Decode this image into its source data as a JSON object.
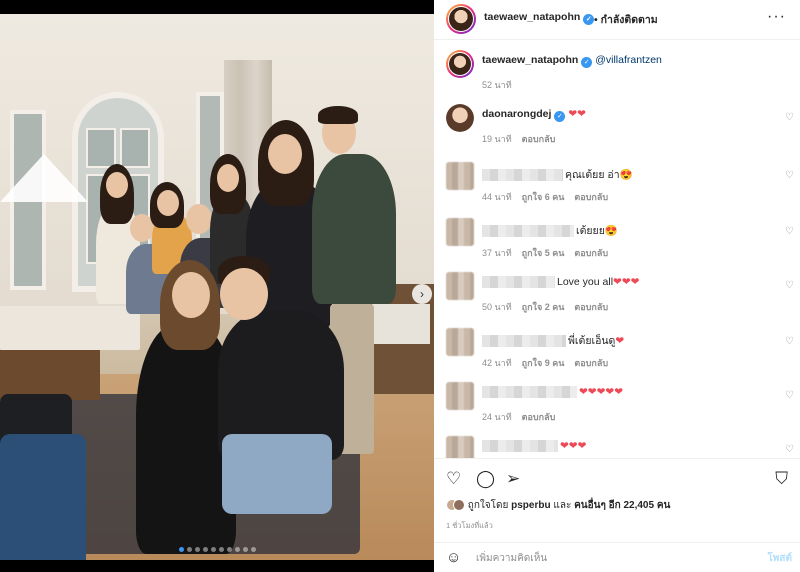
{
  "colors": {
    "accent": "#3897f0",
    "heart_red": "#ed4956",
    "post_disabled": "#b2dffc"
  },
  "header": {
    "username": "taewaew_natapohn",
    "follow_label": "• กำลังติดตาม",
    "more_icon": "more-horizontal-icon"
  },
  "caption": {
    "username": "taewaew_natapohn",
    "mention": "@villafrantzen",
    "time": "52 นาที"
  },
  "comments": [
    {
      "username": "daonarongdej",
      "verified": true,
      "text": "",
      "hearts": "❤❤",
      "time": "19 นาที",
      "likes": "",
      "reply": "ตอบกลับ"
    },
    {
      "username": "",
      "text": "คุณเต้ยย อ่า",
      "emoji": "😍",
      "hearts": "",
      "time": "44 นาที",
      "likes": "ถูกใจ 6 คน",
      "reply": "ตอบกลับ"
    },
    {
      "username": "",
      "text": "เต้ยยย",
      "emoji": "😍",
      "hearts": "",
      "time": "37 นาที",
      "likes": "ถูกใจ 5 คน",
      "reply": "ตอบกลับ"
    },
    {
      "username": "",
      "text": "Love you all",
      "emoji": "",
      "hearts": "❤❤❤",
      "time": "50 นาที",
      "likes": "ถูกใจ 2 คน",
      "reply": "ตอบกลับ"
    },
    {
      "username": "",
      "text": "พี่เต้ยเอ็นดู",
      "emoji": "",
      "hearts": "❤",
      "time": "42 นาที",
      "likes": "ถูกใจ 9 คน",
      "reply": "ตอบกลับ"
    },
    {
      "username": "",
      "text": "",
      "emoji": "",
      "hearts": "❤❤❤❤❤",
      "time": "24 นาที",
      "likes": "",
      "reply": "ตอบกลับ"
    },
    {
      "username": "",
      "text": "",
      "emoji": "",
      "hearts": "❤❤❤",
      "time": "",
      "likes": "",
      "reply": ""
    }
  ],
  "actions": {
    "like_icon": "heart-icon",
    "comment_icon": "comment-icon",
    "share_icon": "send-icon",
    "save_icon": "bookmark-icon"
  },
  "likes_line": {
    "prefix": "ถูกใจโดย",
    "user": "psperbu",
    "middle": "และ",
    "others": "คนอื่นๆ อีก 22,405 คน"
  },
  "time_ago": "1 ชั่วโมงที่แล้ว",
  "add_comment": {
    "placeholder": "เพิ่มความคิดเห็น",
    "post_label": "โพสต์"
  },
  "carousel": {
    "total": 10,
    "active_index": 0,
    "next_icon": "chevron-right-icon"
  }
}
